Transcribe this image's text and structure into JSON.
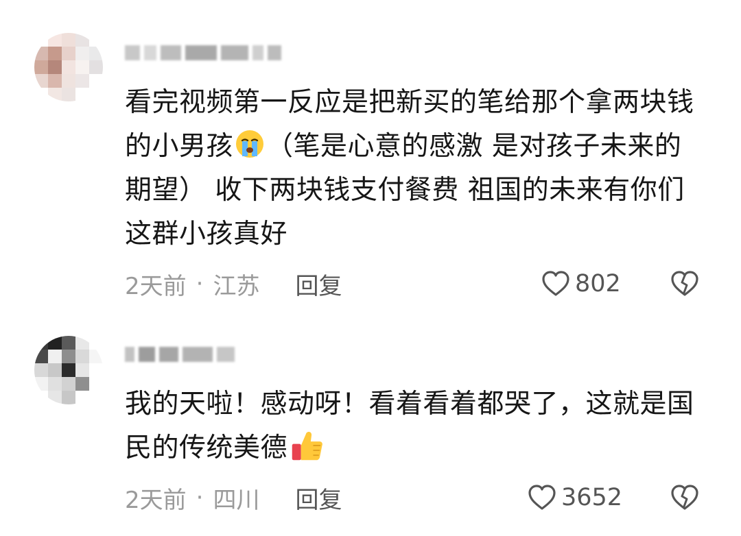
{
  "comments": [
    {
      "text_before_emoji": "看完视频第一反应是把新买的笔给那个拿两块钱的小男孩",
      "emoji": "crying-face-emoji",
      "text_after_emoji": "（笔是心意的感激 是对孩子未来的期望） 收下两块钱支付餐费 祖国的未来有你们这群小孩真好",
      "time": "2天前",
      "separator": "·",
      "location": "江苏",
      "reply_label": "回复",
      "like_count": "802"
    },
    {
      "text_before_emoji": "我的天啦！感动呀！看着看着都哭了，这就是国民的传统美德",
      "emoji": "thumbs-up-emoji",
      "text_after_emoji": "",
      "time": "2天前",
      "separator": "·",
      "location": "四川",
      "reply_label": "回复",
      "like_count": "3652"
    }
  ],
  "colors": {
    "text_primary": "#161616",
    "text_meta": "#9a9a9a",
    "text_action": "#555555",
    "background": "#ffffff"
  }
}
